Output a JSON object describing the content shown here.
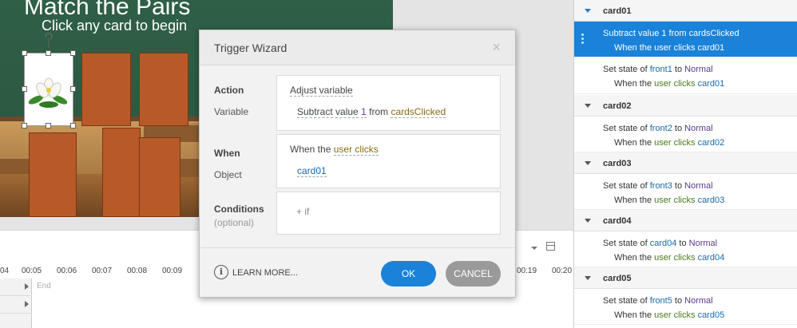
{
  "slide": {
    "title": "Match the Pairs",
    "subtitle": "Click any card to begin"
  },
  "timeline": {
    "ticks": [
      "04",
      "00:05",
      "00:06",
      "00:07",
      "00:08",
      "00:09",
      "00:19",
      "00:20"
    ],
    "end_label": "End"
  },
  "dialog": {
    "title": "Trigger Wizard",
    "close_glyph": "×",
    "action": {
      "label": "Action",
      "value": "Adjust variable",
      "variable_label": "Variable",
      "op_word": "Subtract",
      "op_value_word": "value",
      "op_value": "1",
      "op_from": "from",
      "variable": "cardsClicked"
    },
    "when": {
      "label": "When",
      "prefix": "When the",
      "event": "user clicks",
      "object_label": "Object",
      "object": "card01"
    },
    "conditions": {
      "label": "Conditions",
      "optional": "(optional)",
      "add": "+ if"
    },
    "learn_more": "LEARN MORE...",
    "ok": "OK",
    "cancel": "CANCEL"
  },
  "triggers_panel": {
    "groups": [
      {
        "name": "card01",
        "selected": true,
        "trigger": {
          "line1": "Subtract value 1 from cardsClicked",
          "line2": "When the user clicks card01"
        }
      },
      {
        "name": "",
        "selected": false,
        "trigger": {
          "set": "Set state of",
          "obj": "front1",
          "to": "to",
          "state": "Normal",
          "when": "When the",
          "event": "user clicks",
          "target": "card01"
        }
      },
      {
        "name": "card02",
        "selected": false,
        "trigger": {
          "set": "Set state of",
          "obj": "front2",
          "to": "to",
          "state": "Normal",
          "when": "When the",
          "event": "user clicks",
          "target": "card02"
        }
      },
      {
        "name": "card03",
        "selected": false,
        "trigger": {
          "set": "Set state of",
          "obj": "front3",
          "to": "to",
          "state": "Normal",
          "when": "When the",
          "event": "user clicks",
          "target": "card03"
        }
      },
      {
        "name": "card04",
        "selected": false,
        "trigger": {
          "set": "Set state of",
          "obj": "card04",
          "to": "to",
          "state": "Normal",
          "when": "When the",
          "event": "user clicks",
          "target": "card04"
        }
      },
      {
        "name": "card05",
        "selected": false,
        "trigger": {
          "set": "Set state of",
          "obj": "front5",
          "to": "to",
          "state": "Normal",
          "when": "When the",
          "event": "user clicks",
          "target": "card05"
        }
      }
    ]
  },
  "colors": {
    "accent": "#1a82d8",
    "cancel": "#9a9a9a",
    "card": "#b85a28"
  }
}
